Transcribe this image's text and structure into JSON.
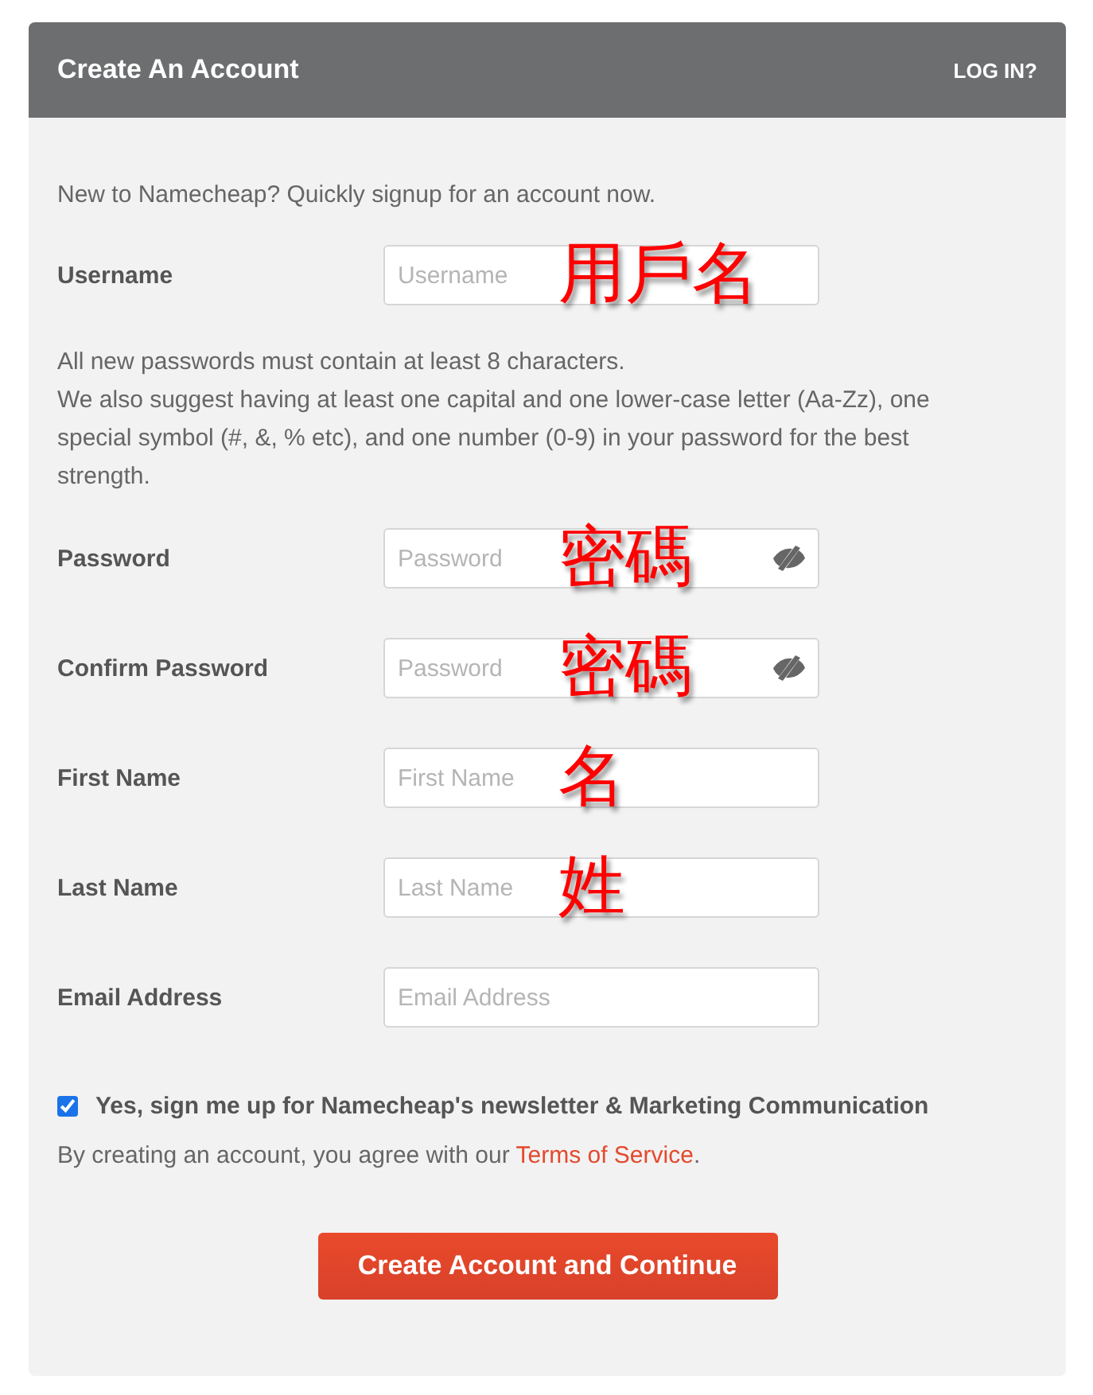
{
  "header": {
    "title": "Create An Account",
    "login_link": "LOG IN?"
  },
  "form": [
    {
      "kind": "intro",
      "text": "New to Namecheap? Quickly signup for an account now."
    },
    {
      "kind": "field",
      "label": "Username",
      "placeholder": "Username",
      "masked": false,
      "annotation": "用戶名"
    },
    {
      "kind": "note",
      "lines": [
        "All new passwords must contain at least 8 characters.",
        "We also suggest having at least one capital and one lower-case letter (Aa-Zz), one special symbol (#, &, % etc), and one number (0-9) in your password for the best strength."
      ]
    },
    {
      "kind": "field",
      "label": "Password",
      "placeholder": "Password",
      "masked": true,
      "annotation": "密碼"
    },
    {
      "kind": "field",
      "label": "Confirm Password",
      "placeholder": "Password",
      "masked": true,
      "annotation": "密碼"
    },
    {
      "kind": "field",
      "label": "First Name",
      "placeholder": "First Name",
      "masked": false,
      "annotation": "名"
    },
    {
      "kind": "field",
      "label": "Last Name",
      "placeholder": "Last Name",
      "masked": false,
      "annotation": "姓"
    },
    {
      "kind": "field",
      "label": "Email Address",
      "placeholder": "Email Address",
      "masked": false
    }
  ],
  "newsletter": {
    "label": "Yes, sign me up for Namecheap's newsletter & Marketing Communication",
    "checked": true
  },
  "terms": {
    "before": "By creating an account, you agree with our ",
    "link": "Terms of Service",
    "after": "."
  },
  "submit": "Create Account and Continue"
}
